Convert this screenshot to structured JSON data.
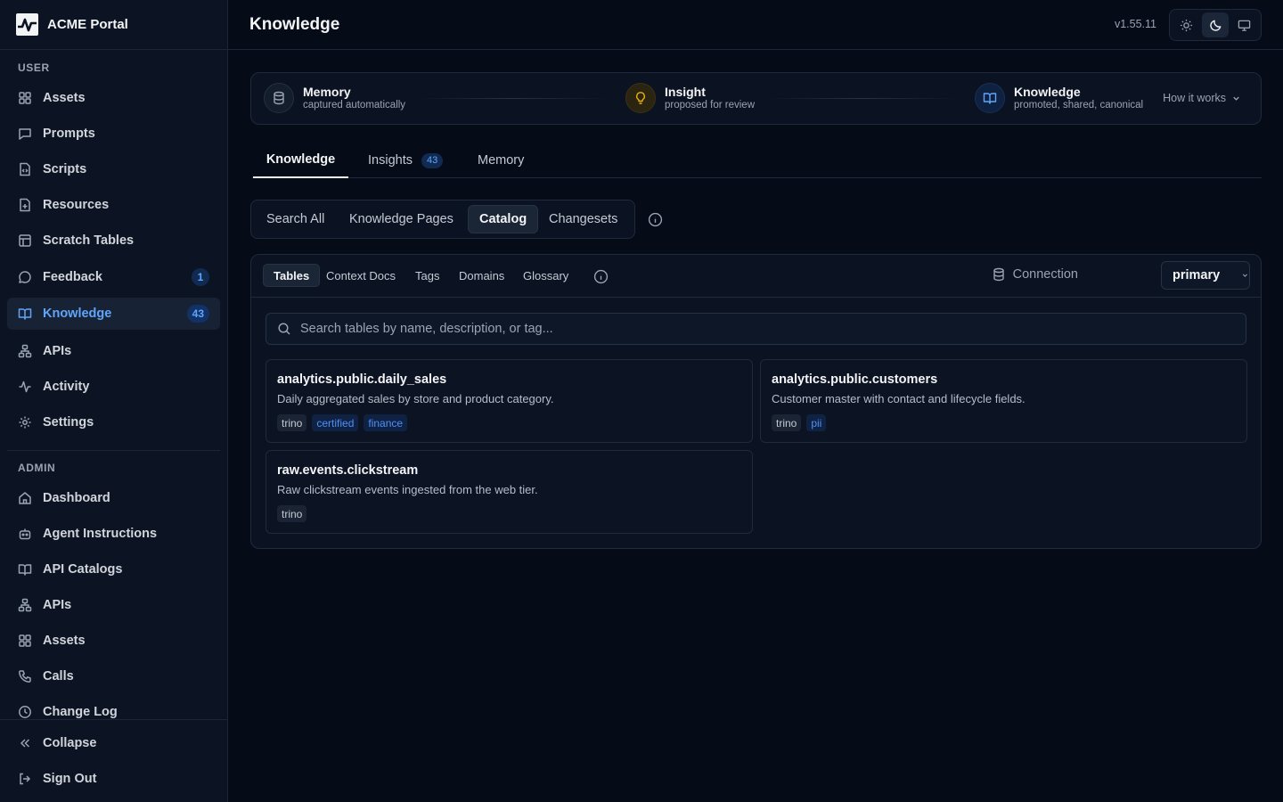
{
  "app": {
    "name": "ACME Portal",
    "version": "v1.55.11"
  },
  "sidebar": {
    "user_section": "USER",
    "user_items": [
      {
        "label": "Assets",
        "icon": "grid-icon"
      },
      {
        "label": "Prompts",
        "icon": "message-square-icon"
      },
      {
        "label": "Scripts",
        "icon": "file-code-icon"
      },
      {
        "label": "Resources",
        "icon": "file-icon"
      },
      {
        "label": "Scratch Tables",
        "icon": "table-icon"
      },
      {
        "label": "Feedback",
        "icon": "message-circle-icon",
        "badge": "1"
      },
      {
        "label": "Knowledge",
        "icon": "book-open-icon",
        "badge": "43",
        "active": true
      },
      {
        "label": "APIs",
        "icon": "network-icon"
      },
      {
        "label": "Activity",
        "icon": "activity-icon"
      },
      {
        "label": "Settings",
        "icon": "gear-icon"
      }
    ],
    "admin_section": "ADMIN",
    "admin_items": [
      {
        "label": "Dashboard",
        "icon": "home-icon"
      },
      {
        "label": "Agent Instructions",
        "icon": "bot-icon"
      },
      {
        "label": "API Catalogs",
        "icon": "book-open-icon"
      },
      {
        "label": "APIs",
        "icon": "network-icon"
      },
      {
        "label": "Assets",
        "icon": "grid-icon"
      },
      {
        "label": "Calls",
        "icon": "phone-icon"
      },
      {
        "label": "Change Log",
        "icon": "clock-icon"
      }
    ],
    "collapse_label": "Collapse",
    "signout_label": "Sign Out"
  },
  "header": {
    "title": "Knowledge"
  },
  "pipeline": {
    "stages": [
      {
        "title": "Memory",
        "subtitle": "captured automatically",
        "icon": "database-icon"
      },
      {
        "title": "Insight",
        "subtitle": "proposed for review",
        "icon": "lightbulb-icon",
        "color": "#eab308"
      },
      {
        "title": "Knowledge",
        "subtitle": "promoted, shared, canonical",
        "icon": "book-open-icon",
        "color": "#60a5fa"
      }
    ],
    "how_it_works": "How it works"
  },
  "tabs": [
    {
      "label": "Knowledge",
      "active": true
    },
    {
      "label": "Insights",
      "badge": "43"
    },
    {
      "label": "Memory"
    }
  ],
  "views": [
    {
      "label": "Search All"
    },
    {
      "label": "Knowledge Pages"
    },
    {
      "label": "Catalog",
      "active": true
    },
    {
      "label": "Changesets"
    }
  ],
  "catalog": {
    "subtabs": [
      {
        "label": "Tables",
        "active": true
      },
      {
        "label": "Context Docs"
      },
      {
        "label": "Tags"
      },
      {
        "label": "Domains"
      },
      {
        "label": "Glossary"
      }
    ],
    "connection_label": "Connection",
    "connection_value": "primary",
    "search_placeholder": "Search tables by name, description, or tag...",
    "tables": [
      {
        "name": "analytics.public.daily_sales",
        "description": "Daily aggregated sales by store and product category.",
        "tags": [
          "trino",
          "certified",
          "finance"
        ]
      },
      {
        "name": "analytics.public.customers",
        "description": "Customer master with contact and lifecycle fields.",
        "tags": [
          "trino",
          "pii"
        ]
      },
      {
        "name": "raw.events.clickstream",
        "description": "Raw clickstream events ingested from the web tier.",
        "tags": [
          "trino"
        ]
      }
    ]
  },
  "colors": {
    "accent": "#60a5fa",
    "insight": "#eab308",
    "background": "#050b17",
    "sidebar": "#0c1423"
  }
}
